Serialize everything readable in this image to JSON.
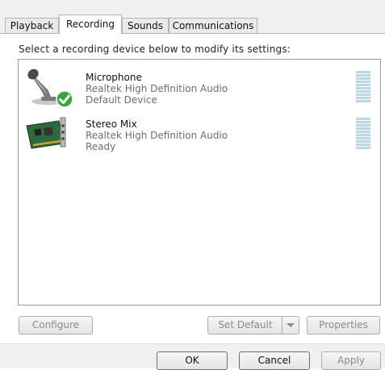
{
  "tabs": [
    {
      "label": "Playback",
      "active": false
    },
    {
      "label": "Recording",
      "active": true
    },
    {
      "label": "Sounds",
      "active": false
    },
    {
      "label": "Communications",
      "active": false
    }
  ],
  "instruction": "Select a recording device below to modify its settings:",
  "devices": [
    {
      "name": "Microphone",
      "description": "Realtek High Definition Audio",
      "status": "Default Device",
      "icon": "microphone-icon",
      "default_badge": "check-badge-icon"
    },
    {
      "name": "Stereo Mix",
      "description": "Realtek High Definition Audio",
      "status": "Ready",
      "icon": "sound-card-icon"
    }
  ],
  "buttons": {
    "configure": "Configure",
    "set_default": "Set Default",
    "properties": "Properties",
    "ok": "OK",
    "cancel": "Cancel",
    "apply": "Apply"
  },
  "colors": {
    "level_meter": "#b9d8e4",
    "default_check": "#3aa53a"
  }
}
